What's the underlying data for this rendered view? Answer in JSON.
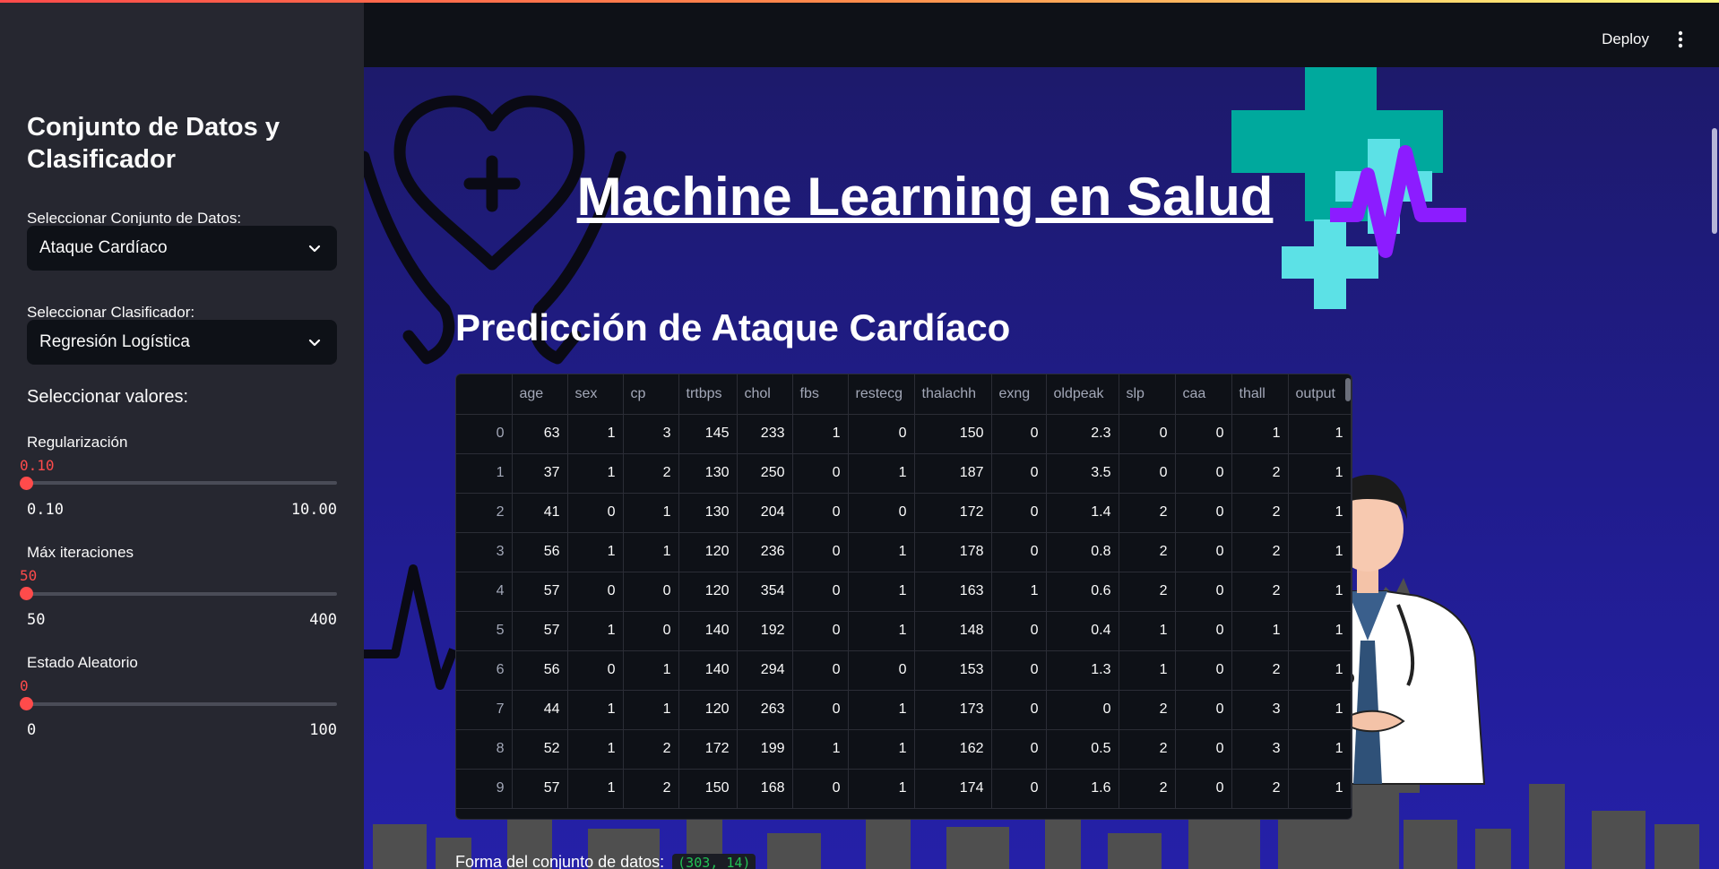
{
  "header": {
    "deploy_label": "Deploy"
  },
  "sidebar": {
    "title": "Conjunto de Datos y Clasificador",
    "dataset": {
      "label": "Seleccionar Conjunto de Datos:",
      "value": "Ataque Cardíaco"
    },
    "classifier": {
      "label": "Seleccionar Clasificador:",
      "value": "Regresión Logística"
    },
    "values_heading": "Seleccionar valores:",
    "sliders": [
      {
        "label": "Regularización",
        "value": "0.10",
        "min": "0.10",
        "max": "10.00"
      },
      {
        "label": "Máx iteraciones",
        "value": "50",
        "min": "50",
        "max": "400"
      },
      {
        "label": "Estado Aleatorio",
        "value": "0",
        "min": "0",
        "max": "100"
      }
    ]
  },
  "main": {
    "title": "Machine Learning en Salud",
    "subtitle": "Predicción de Ataque Cardíaco",
    "table": {
      "columns": [
        "",
        "age",
        "sex",
        "cp",
        "trtbps",
        "chol",
        "fbs",
        "restecg",
        "thalachh",
        "exng",
        "oldpeak",
        "slp",
        "caa",
        "thall",
        "output"
      ],
      "rows": [
        [
          "0",
          "63",
          "1",
          "3",
          "145",
          "233",
          "1",
          "0",
          "150",
          "0",
          "2.3",
          "0",
          "0",
          "1",
          "1"
        ],
        [
          "1",
          "37",
          "1",
          "2",
          "130",
          "250",
          "0",
          "1",
          "187",
          "0",
          "3.5",
          "0",
          "0",
          "2",
          "1"
        ],
        [
          "2",
          "41",
          "0",
          "1",
          "130",
          "204",
          "0",
          "0",
          "172",
          "0",
          "1.4",
          "2",
          "0",
          "2",
          "1"
        ],
        [
          "3",
          "56",
          "1",
          "1",
          "120",
          "236",
          "0",
          "1",
          "178",
          "0",
          "0.8",
          "2",
          "0",
          "2",
          "1"
        ],
        [
          "4",
          "57",
          "0",
          "0",
          "120",
          "354",
          "0",
          "1",
          "163",
          "1",
          "0.6",
          "2",
          "0",
          "2",
          "1"
        ],
        [
          "5",
          "57",
          "1",
          "0",
          "140",
          "192",
          "0",
          "1",
          "148",
          "0",
          "0.4",
          "1",
          "0",
          "1",
          "1"
        ],
        [
          "6",
          "56",
          "0",
          "1",
          "140",
          "294",
          "0",
          "0",
          "153",
          "0",
          "1.3",
          "1",
          "0",
          "2",
          "1"
        ],
        [
          "7",
          "44",
          "1",
          "1",
          "120",
          "263",
          "0",
          "1",
          "173",
          "0",
          "0",
          "2",
          "0",
          "3",
          "1"
        ],
        [
          "8",
          "52",
          "1",
          "2",
          "172",
          "199",
          "1",
          "1",
          "162",
          "0",
          "0.5",
          "2",
          "0",
          "3",
          "1"
        ],
        [
          "9",
          "57",
          "1",
          "2",
          "150",
          "168",
          "0",
          "1",
          "174",
          "0",
          "1.6",
          "2",
          "0",
          "2",
          "1"
        ]
      ]
    },
    "shape_label": "Forma del conjunto de datos:",
    "shape_value": "(303, 14)"
  },
  "colors": {
    "accent": "#ff4b4b",
    "sidebar_bg": "#262730",
    "app_bg": "#0e1117",
    "medical_teal": "#00a99d",
    "medical_cyan": "#5ce1e6",
    "pulse_purple": "#8c1cff"
  },
  "icons": [
    "chevron-down-icon",
    "kebab-menu-icon",
    "heart-hands-icon",
    "medical-cross-icon",
    "heartbeat-icon",
    "doctor-illustration"
  ]
}
